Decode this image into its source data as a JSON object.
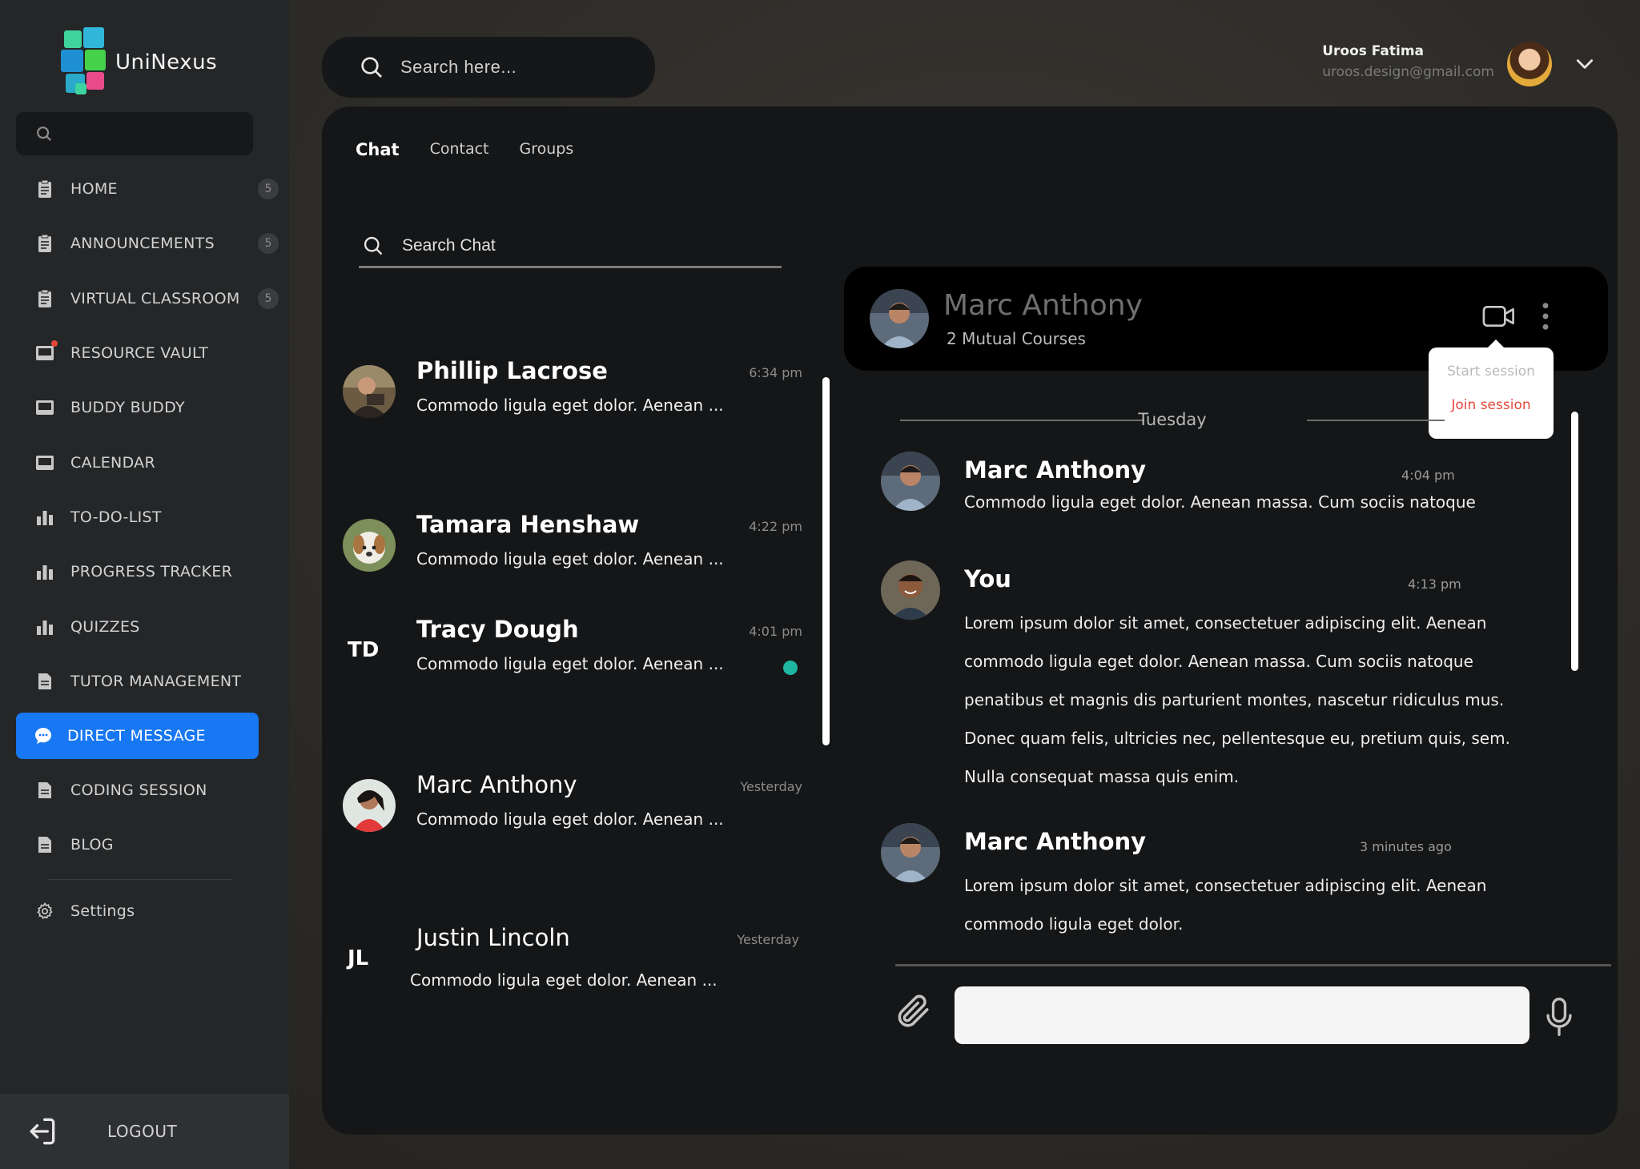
{
  "app": {
    "name": "UniNexus"
  },
  "sidebar": {
    "items": [
      {
        "label": "HOME",
        "badge": "5",
        "icon": "document-icon"
      },
      {
        "label": "ANNOUNCEMENTS",
        "badge": "5",
        "icon": "document-icon"
      },
      {
        "label": "VIRTUAL CLASSROOM",
        "badge": "5",
        "icon": "document-icon"
      },
      {
        "label": "RESOURCE VAULT",
        "badge": "",
        "icon": "inbox-icon"
      },
      {
        "label": "BUDDY BUDDY",
        "badge": "",
        "icon": "inbox-icon"
      },
      {
        "label": "CALENDAR",
        "badge": "",
        "icon": "inbox-icon"
      },
      {
        "label": "TO-DO-LIST",
        "badge": "",
        "icon": "bar-chart-icon"
      },
      {
        "label": "PROGRESS TRACKER",
        "badge": "",
        "icon": "bar-chart-icon"
      },
      {
        "label": "QUIZZES",
        "badge": "",
        "icon": "bar-chart-icon"
      },
      {
        "label": "TUTOR MANAGEMENT",
        "badge": "",
        "icon": "file-icon"
      },
      {
        "label": "DIRECT MESSAGE",
        "badge": "",
        "icon": "chat-bubble-icon",
        "active": true
      },
      {
        "label": "CODING SESSION",
        "badge": "",
        "icon": "file-icon"
      },
      {
        "label": "BLOG",
        "badge": "",
        "icon": "file-icon"
      }
    ],
    "settings_label": "Settings",
    "logout_label": "LOGOUT"
  },
  "header": {
    "search_placeholder": "Search here...",
    "user_name": "Uroos Fatima",
    "user_email": "uroos.design@gmail.com"
  },
  "tabs": [
    {
      "label": "Chat",
      "active": true
    },
    {
      "label": "Contact",
      "active": false
    },
    {
      "label": "Groups",
      "active": false
    }
  ],
  "chat_search_placeholder": "Search Chat",
  "conversations": [
    {
      "name": "Phillip Lacrose",
      "preview": "Commodo ligula eget dolor. Aenean ...",
      "time": "6:34 pm",
      "bold": true
    },
    {
      "name": "Tamara Henshaw",
      "preview": "Commodo ligula eget dolor. Aenean ...",
      "time": "4:22 pm",
      "bold": true
    },
    {
      "name": "Tracy Dough",
      "preview": "Commodo ligula eget dolor. Aenean ...",
      "time": "4:01 pm",
      "bold": true,
      "initials": "TD",
      "online": true
    },
    {
      "name": "Marc Anthony",
      "preview": "Commodo ligula eget dolor. Aenean ...",
      "time": "Yesterday",
      "bold": false
    },
    {
      "name": "Justin Lincoln",
      "preview": "Commodo ligula eget dolor. Aenean ...",
      "time": "Yesterday",
      "bold": false,
      "initials": "JL"
    }
  ],
  "conversation": {
    "name": "Marc Anthony",
    "subtitle": "2 Mutual Courses",
    "session_menu": {
      "start": "Start session",
      "join": "Join session"
    },
    "day_label": "Tuesday",
    "messages": [
      {
        "sender": "Marc Anthony",
        "time": "4:04 pm",
        "text": "Commodo ligula eget dolor. Aenean massa. Cum sociis natoque"
      },
      {
        "sender": "You",
        "time": "4:13 pm",
        "text": "Lorem ipsum dolor sit amet, consectetuer adipiscing elit. Aenean commodo ligula eget dolor. Aenean massa. Cum sociis natoque penatibus et magnis dis parturient montes, nascetur ridiculus mus. Donec quam felis, ultricies nec, pellentesque eu, pretium quis, sem. Nulla consequat massa quis enim."
      },
      {
        "sender": "Marc Anthony",
        "time": "3 minutes ago",
        "text": "Lorem ipsum dolor sit amet, consectetuer adipiscing elit. Aenean commodo ligula eget dolor."
      }
    ]
  },
  "colors": {
    "accent": "#1877f2",
    "online": "#1fb5a3",
    "join": "#e5473c"
  }
}
